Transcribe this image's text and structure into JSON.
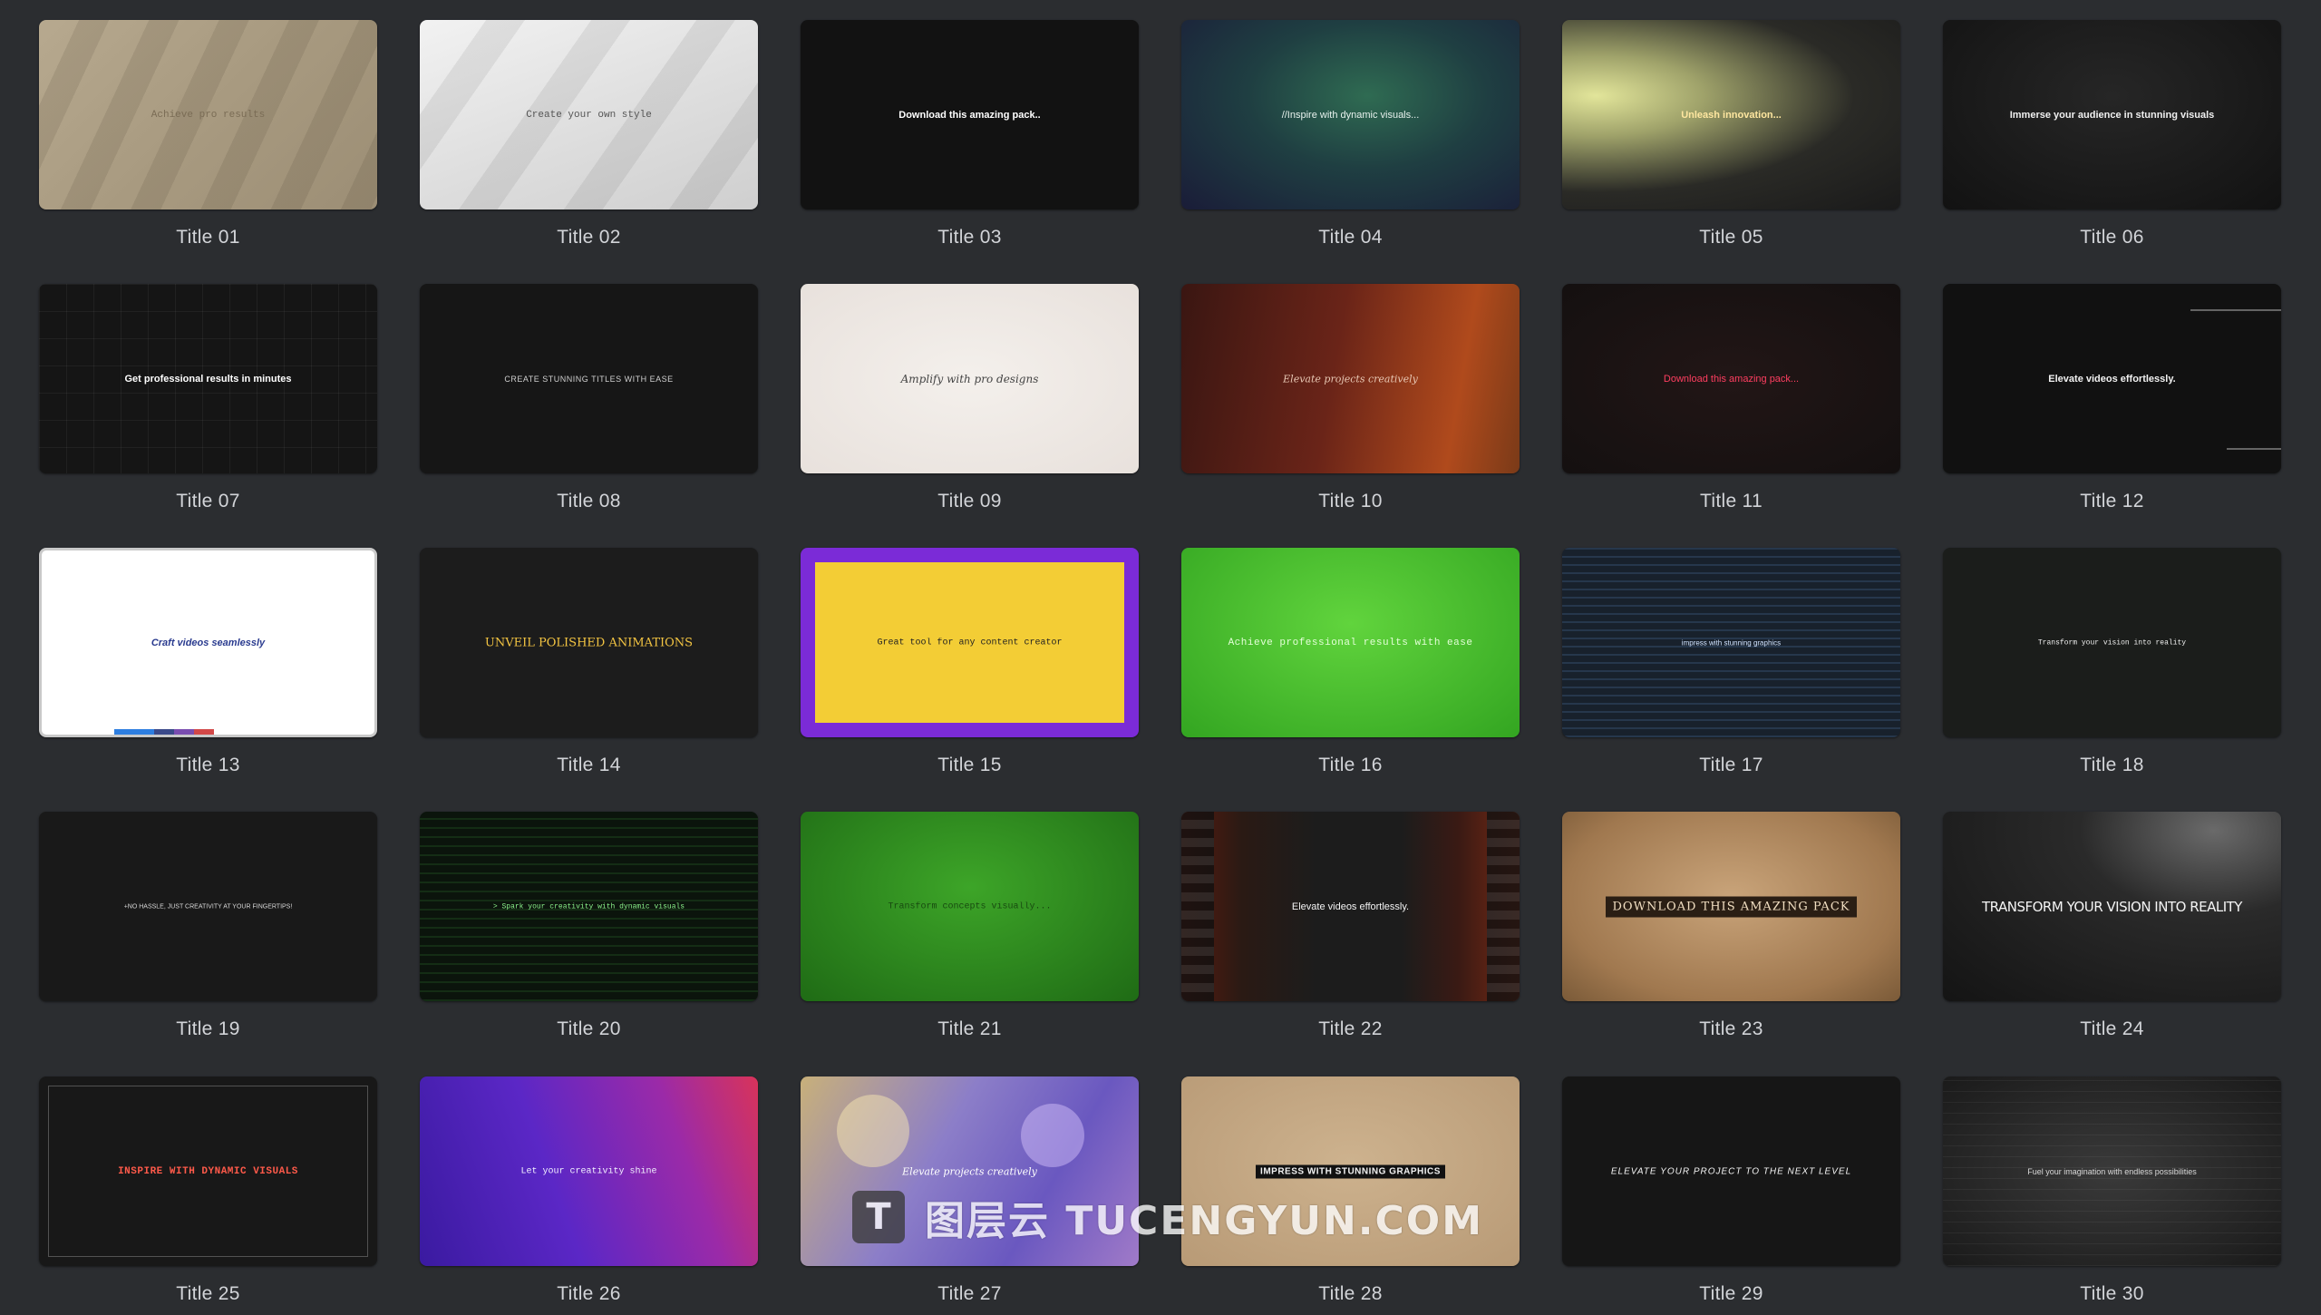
{
  "tiles": [
    {
      "thumb_text": "Achieve pro results",
      "caption": "Title 01"
    },
    {
      "thumb_text": "Create your own style",
      "caption": "Title 02"
    },
    {
      "thumb_text": "Download this amazing pack..",
      "caption": "Title 03"
    },
    {
      "thumb_text": "//Inspire with dynamic visuals...",
      "caption": "Title 04"
    },
    {
      "thumb_text": "Unleash innovation...",
      "caption": "Title 05"
    },
    {
      "thumb_text": "Immerse your audience in stunning visuals",
      "caption": "Title 06"
    },
    {
      "thumb_text": "Get professional results in minutes",
      "caption": "Title 07"
    },
    {
      "thumb_text": "CREATE STUNNING TITLES WITH EASE",
      "caption": "Title 08"
    },
    {
      "thumb_text": "Amplify with pro designs",
      "caption": "Title 09"
    },
    {
      "thumb_text": "Elevate projects creatively",
      "caption": "Title 10"
    },
    {
      "thumb_text": "Download this amazing pack...",
      "caption": "Title 11"
    },
    {
      "thumb_text": "Elevate videos effortlessly.",
      "caption": "Title 12"
    },
    {
      "thumb_text": "Craft videos seamlessly",
      "caption": "Title 13"
    },
    {
      "thumb_text": "UNVEIL POLISHED ANIMATIONS",
      "caption": "Title 14"
    },
    {
      "thumb_text": "Great tool for any content creator",
      "caption": "Title 15"
    },
    {
      "thumb_text": "Achieve professional results with ease",
      "caption": "Title 16"
    },
    {
      "thumb_text": "impress with stunning graphics",
      "caption": "Title 17"
    },
    {
      "thumb_text": "Transform your vision into reality",
      "caption": "Title 18"
    },
    {
      "thumb_text": "+NO HASSLE, JUST CREATIVITY AT YOUR FINGERTIPS!",
      "caption": "Title 19"
    },
    {
      "thumb_text": "> Spark your creativity with dynamic visuals",
      "caption": "Title 20"
    },
    {
      "thumb_text": "Transform concepts visually...",
      "caption": "Title 21"
    },
    {
      "thumb_text": "Elevate videos effortlessly.",
      "caption": "Title 22"
    },
    {
      "thumb_text": "DOWNLOAD THIS AMAZING PACK",
      "caption": "Title 23"
    },
    {
      "thumb_text": "TRANSFORM YOUR VISION INTO REALITY",
      "caption": "Title 24"
    },
    {
      "thumb_text": "INSPIRE WITH DYNAMIC VISUALS",
      "caption": "Title 25"
    },
    {
      "thumb_text": "Let your creativity shine",
      "caption": "Title 26"
    },
    {
      "thumb_text": "Elevate projects creatively",
      "caption": "Title 27"
    },
    {
      "thumb_text": "IMPRESS WITH STUNNING GRAPHICS",
      "caption": "Title 28"
    },
    {
      "thumb_text": "ELEVATE YOUR PROJECT TO THE NEXT LEVEL",
      "caption": "Title 29"
    },
    {
      "thumb_text": "Fuel your imagination with endless possibilities",
      "caption": "Title 30"
    }
  ],
  "watermark": {
    "logo_letter": "T",
    "text": "图层云 TUCENGYUN.COM"
  }
}
